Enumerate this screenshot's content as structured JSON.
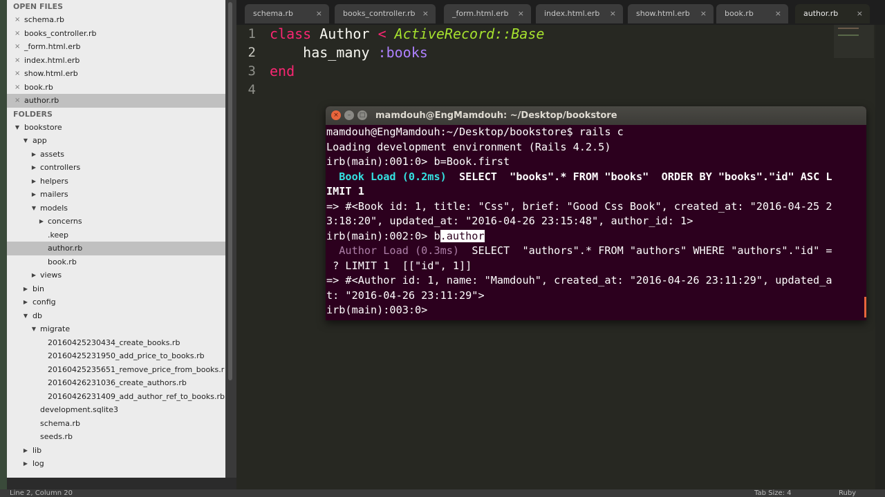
{
  "sidebar": {
    "open_files_header": "OPEN FILES",
    "folders_header": "FOLDERS",
    "open_files": [
      "schema.rb",
      "books_controller.rb",
      "_form.html.erb",
      "index.html.erb",
      "show.html.erb",
      "book.rb",
      "author.rb"
    ],
    "selected_open_file": "author.rb",
    "close_glyph": "×",
    "tree": {
      "bookstore": "bookstore",
      "app": "app",
      "assets": "assets",
      "controllers": "controllers",
      "helpers": "helpers",
      "mailers": "mailers",
      "models": "models",
      "concerns": "concerns",
      "keep": ".keep",
      "author_rb": "author.rb",
      "book_rb": "book.rb",
      "views": "views",
      "bin": "bin",
      "config": "config",
      "db": "db",
      "migrate": "migrate",
      "migrations": [
        "20160425230434_create_books.rb",
        "20160425231950_add_price_to_books.rb",
        "20160425235651_remove_price_from_books.r",
        "20160426231036_create_authors.rb",
        "20160426231409_add_author_ref_to_books.rb"
      ],
      "dev_sqlite": "development.sqlite3",
      "schema_rb": "schema.rb",
      "seeds_rb": "seeds.rb",
      "lib": "lib",
      "log": "log"
    }
  },
  "tabs": [
    "schema.rb",
    "books_controller.rb",
    "_form.html.erb",
    "index.html.erb",
    "show.html.erb",
    "book.rb",
    "author.rb"
  ],
  "active_tab": "author.rb",
  "tab_close_glyph": "×",
  "editor": {
    "line_numbers": [
      "1",
      "2",
      "3",
      "4"
    ],
    "kw_class": "class",
    "class_name": "Author",
    "op_lt": "<",
    "parent_class": "ActiveRecord::Base",
    "has_many": "has_many",
    "sym_books": ":books",
    "kw_end": "end"
  },
  "terminal": {
    "title": "mamdouh@EngMamdouh: ~/Desktop/bookstore",
    "btn_close": "×",
    "btn_min": "–",
    "btn_max": "□",
    "line1": "mamdouh@EngMamdouh:~/Desktop/bookstore$ rails c",
    "line2": "Loading development environment (Rails 4.2.5)",
    "line3": "irb(main):001:0> b=Book.first",
    "line4_load": "  Book Load (0.2ms)",
    "line4_sql": "  SELECT  \"books\".* FROM \"books\"  ORDER BY \"books\".\"id\" ASC L",
    "line5": "IMIT 1",
    "line6": "=> #<Book id: 1, title: \"Css\", brief: \"Good Css Book\", created_at: \"2016-04-25 2",
    "line7": "3:18:20\", updated_at: \"2016-04-26 23:15:48\", author_id: 1>",
    "line8_prompt": "irb(main):002:0> b",
    "line8_sel": ".author",
    "line9_load": "  Author Load (0.3ms)",
    "line9_sql": "  SELECT  \"authors\".* FROM \"authors\" WHERE \"authors\".\"id\" =",
    "line10": " ? LIMIT 1  [[\"id\", 1]]",
    "line11": "=> #<Author id: 1, name: \"Mamdouh\", created_at: \"2016-04-26 23:11:29\", updated_a",
    "line12": "t: \"2016-04-26 23:11:29\">",
    "line13": "irb(main):003:0> "
  },
  "status": {
    "cursor_position": "Line 2, Column 20",
    "tab_size": "Tab Size: 4",
    "syntax": "Ruby"
  },
  "colors": {
    "editor_bg": "#272822",
    "terminal_bg": "#2c001e",
    "keyword": "#f92672",
    "inherited_class": "#a6e22e",
    "symbol": "#ae81ff",
    "sql_load": "#34e2e2",
    "close_button": "#e8653c"
  }
}
